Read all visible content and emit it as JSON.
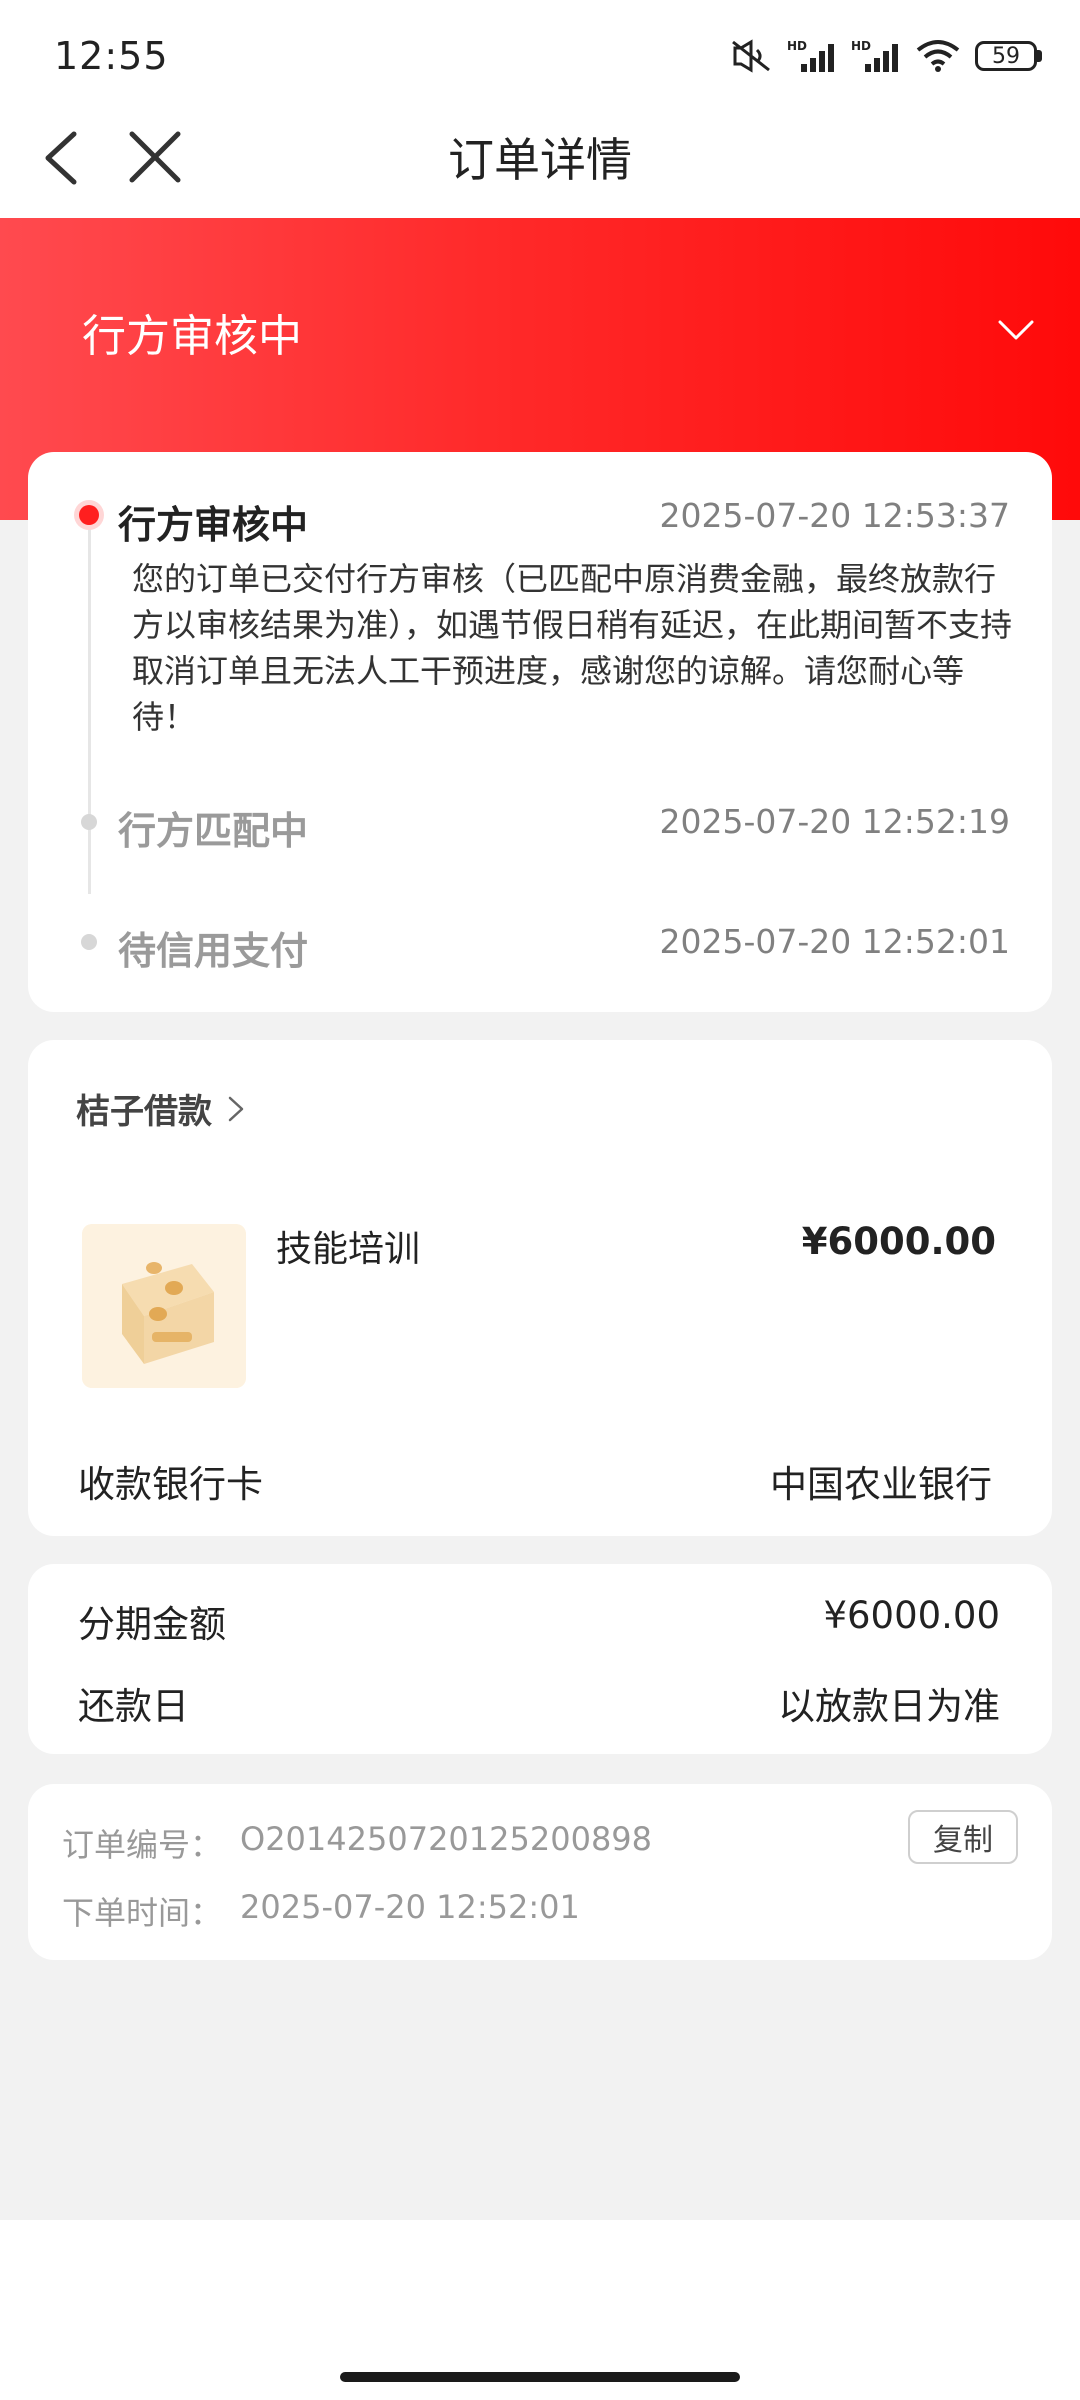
{
  "status_bar": {
    "time": "12:55",
    "icons": [
      "mute-icon",
      "signal-hd-icon",
      "signal-hd-icon",
      "wifi-icon"
    ],
    "battery": "59"
  },
  "nav": {
    "title": "订单详情"
  },
  "hero": {
    "status": "行方审核中"
  },
  "timeline": [
    {
      "title": "行方审核中",
      "time": "2025-07-20 12:53:37",
      "desc": "您的订单已交付行方审核（已匹配中原消费金融，最终放款行方以审核结果为准），如遇节假日稍有延迟，在此期间暂不支持取消订单且无法人工干预进度，感谢您的谅解。请您耐心等待！",
      "active": true
    },
    {
      "title": "行方匹配中",
      "time": "2025-07-20 12:52:19",
      "active": false
    },
    {
      "title": "待信用支付",
      "time": "2025-07-20 12:52:01",
      "active": false
    }
  ],
  "product": {
    "merchant": "桔子借款",
    "name": "技能培训",
    "price": "¥6000.00",
    "bank_label": "收款银行卡",
    "bank_value": "中国农业银行"
  },
  "amount": {
    "installment_label": "分期金额",
    "installment_value": "¥6000.00",
    "repay_label": "还款日",
    "repay_value": "以放款日为准"
  },
  "order": {
    "number_label": "订单编号：",
    "number_value": "O2014250720125200898",
    "time_label": "下单时间：",
    "time_value": "2025-07-20 12:52:01",
    "copy_label": "复制"
  },
  "colors": {
    "brand_red": "#ff1f1f",
    "active_dot": "#ff1f1f",
    "inactive_text": "#9a9a9a"
  }
}
